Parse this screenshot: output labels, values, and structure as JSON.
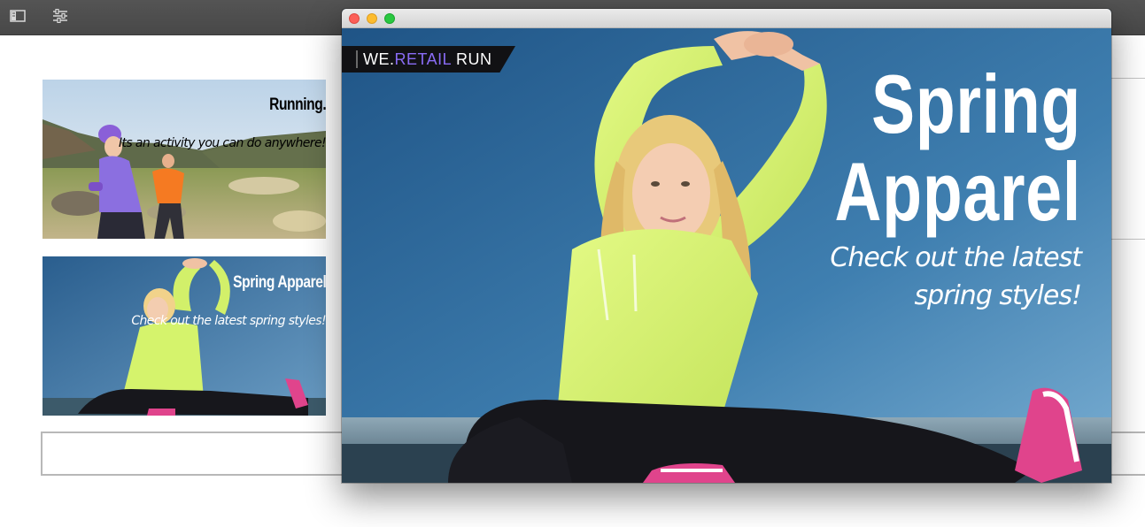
{
  "toolbar": {
    "buttons": [
      {
        "name": "side-panel-toggle",
        "icon": "side-panel-icon"
      },
      {
        "name": "page-properties",
        "icon": "sliders-icon"
      }
    ]
  },
  "teasers": [
    {
      "title": "Running.",
      "description": "Its an activity you can do anywhere!"
    },
    {
      "title": "Spring Apparel",
      "description": "Check out the latest spring styles!"
    }
  ],
  "preview": {
    "window_controls": [
      "close",
      "minimize",
      "zoom"
    ],
    "brand": {
      "part1": "WE.",
      "part2": "RETAIL",
      "part3": " RUN",
      "accent_color": "#8a6cf5"
    },
    "title_lines": [
      "Spring",
      "Apparel"
    ],
    "description": "Check out the latest spring styles!"
  },
  "colors": {
    "toolbar_bg": "#4e4e4e",
    "sky_blue": "#2f6b9c",
    "jacket_lime": "#d6f46c",
    "shoe_pink": "#e0448c",
    "runner_purple": "#7b5bd6",
    "runner_orange": "#f57a22"
  }
}
